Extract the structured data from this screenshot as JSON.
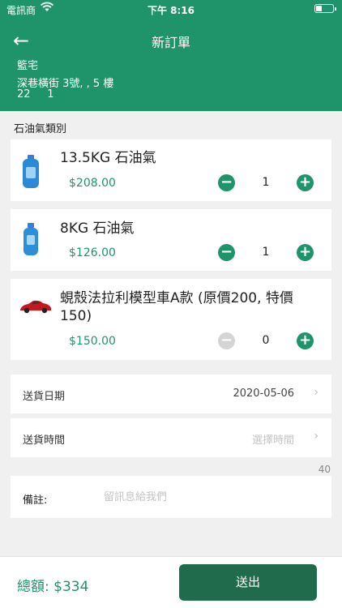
{
  "status_bar": {
    "carrier": "電訊商",
    "time": "下午 8:16",
    "battery_level": 0.35
  },
  "header": {
    "title": "新訂單",
    "address_lines": [
      "籃宅",
      "深巷橫街 3號, , 5 樓",
      "22     1"
    ]
  },
  "products_section_label": "石油氣類別",
  "products": [
    {
      "name": "13.5KG 石油氣",
      "price": "$208.00",
      "qty": "1",
      "thumb": "lpg-cylinder-icon"
    },
    {
      "name": "8KG 石油氣",
      "price": "$126.00",
      "qty": "1",
      "thumb": "lpg-cylinder-icon"
    },
    {
      "name": "蜆殼法拉利模型車A款 (原價200, 特價150)",
      "price": "$150.00",
      "qty": "0",
      "thumb": "red-car-icon"
    }
  ],
  "delivery_date": {
    "label": "送貨日期",
    "value": "2020-05-06"
  },
  "delivery_time": {
    "label": "送貨時間",
    "placeholder": "選擇時間"
  },
  "note": {
    "counter": "40",
    "label": "備註:",
    "placeholder": "留訊息給我們"
  },
  "footer": {
    "total": "總額: $334",
    "submit_label": "送出"
  },
  "colors": {
    "brand": "#1f946a",
    "button": "#1f6b4c"
  }
}
